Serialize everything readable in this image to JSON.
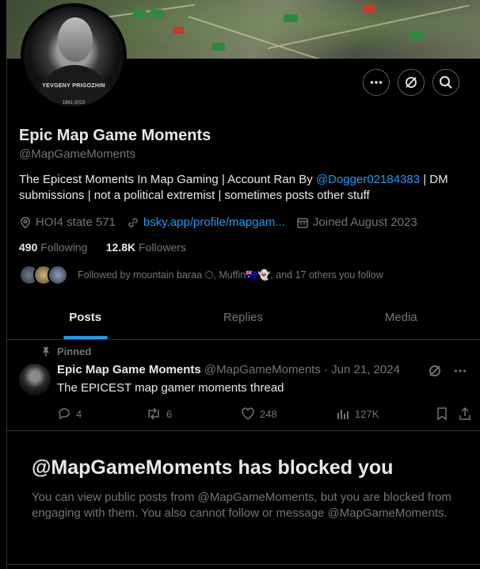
{
  "banner": {
    "label": "map banner"
  },
  "avatar": {
    "caption": "YEVGENY PRIGOZHIN",
    "years": "1961-2023"
  },
  "profile": {
    "name": "Epic Map Game Moments",
    "handle": "@MapGameMoments",
    "bio_part1": "The Epicest Moments In Map Gaming | Account Ran By ",
    "bio_link": "@Dogger02184383",
    "bio_part2": " | DM submissions | not a political extremist | sometimes posts other stuff",
    "location": "HOI4 state 571",
    "website": "bsky.app/profile/mapgam...",
    "joined": "Joined August 2023",
    "following_count": "490",
    "following_label": "Following",
    "followers_count": "12.8K",
    "followers_label": "Followers",
    "followed_by": "Followed by mountain baraa ⬡, Muffin🇦🇺👻, and 17 others you follow"
  },
  "tabs": [
    {
      "label": "Posts"
    },
    {
      "label": "Replies"
    },
    {
      "label": "Media"
    }
  ],
  "post": {
    "pinned_label": "Pinned",
    "author": "Epic Map Game Moments",
    "handle": "@MapGameMoments",
    "sep": "·",
    "date": "Jun 21, 2024",
    "text": "The EPICEST map gamer moments thread",
    "replies": "4",
    "reposts": "6",
    "likes": "248",
    "views": "127K"
  },
  "blocked": {
    "title": "@MapGameMoments has blocked you",
    "body": "You can view public posts from @MapGameMoments, but you are blocked from engaging with them. You also cannot follow or message @MapGameMoments."
  },
  "colors": {
    "accent": "#1d9bf0",
    "muted": "#71767b",
    "text": "#e7e9ea",
    "border": "#2f3336"
  },
  "icons": [
    "more-icon",
    "grok-icon",
    "search-icon",
    "location-icon",
    "link-icon",
    "calendar-icon",
    "pin-icon",
    "reply-icon",
    "repost-icon",
    "like-icon",
    "views-icon",
    "bookmark-icon",
    "share-icon"
  ]
}
